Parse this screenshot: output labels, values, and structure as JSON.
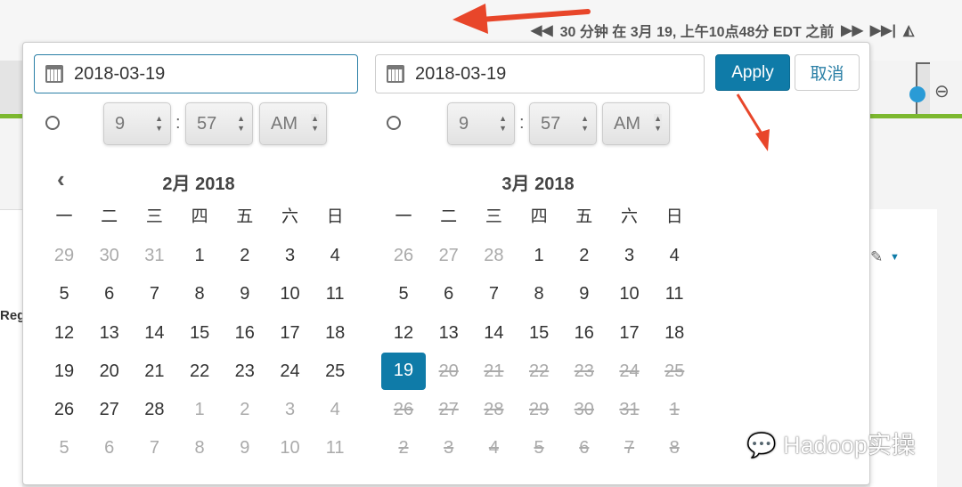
{
  "toolbar": {
    "time_range": "30 分钟 在 3月 19, 上午10点48分 EDT 之前"
  },
  "background": {
    "partial_label": "Reg"
  },
  "picker": {
    "start": {
      "date": "2018-03-19",
      "hour": "9",
      "minute": "57",
      "ampm": "AM"
    },
    "end": {
      "date": "2018-03-19",
      "hour": "9",
      "minute": "57",
      "ampm": "AM"
    },
    "apply_label": "Apply",
    "cancel_label": "取消",
    "time_sep": ":",
    "weekdays": [
      "一",
      "二",
      "三",
      "四",
      "五",
      "六",
      "日"
    ],
    "months": [
      {
        "title": "2月 2018",
        "weeks": [
          [
            [
              "29",
              "muted"
            ],
            [
              "30",
              "muted"
            ],
            [
              "31",
              "muted"
            ],
            [
              "1",
              ""
            ],
            [
              "2",
              ""
            ],
            [
              "3",
              ""
            ],
            [
              "4",
              ""
            ]
          ],
          [
            [
              "5",
              ""
            ],
            [
              "6",
              ""
            ],
            [
              "7",
              ""
            ],
            [
              "8",
              ""
            ],
            [
              "9",
              ""
            ],
            [
              "10",
              ""
            ],
            [
              "11",
              ""
            ]
          ],
          [
            [
              "12",
              ""
            ],
            [
              "13",
              ""
            ],
            [
              "14",
              ""
            ],
            [
              "15",
              ""
            ],
            [
              "16",
              ""
            ],
            [
              "17",
              ""
            ],
            [
              "18",
              ""
            ]
          ],
          [
            [
              "19",
              ""
            ],
            [
              "20",
              ""
            ],
            [
              "21",
              ""
            ],
            [
              "22",
              ""
            ],
            [
              "23",
              ""
            ],
            [
              "24",
              ""
            ],
            [
              "25",
              ""
            ]
          ],
          [
            [
              "26",
              ""
            ],
            [
              "27",
              ""
            ],
            [
              "28",
              ""
            ],
            [
              "1",
              "muted"
            ],
            [
              "2",
              "muted"
            ],
            [
              "3",
              "muted"
            ],
            [
              "4",
              "muted"
            ]
          ],
          [
            [
              "5",
              "muted"
            ],
            [
              "6",
              "muted"
            ],
            [
              "7",
              "muted"
            ],
            [
              "8",
              "muted"
            ],
            [
              "9",
              "muted"
            ],
            [
              "10",
              "muted"
            ],
            [
              "11",
              "muted"
            ]
          ]
        ]
      },
      {
        "title": "3月 2018",
        "weeks": [
          [
            [
              "26",
              "muted"
            ],
            [
              "27",
              "muted"
            ],
            [
              "28",
              "muted"
            ],
            [
              "1",
              ""
            ],
            [
              "2",
              ""
            ],
            [
              "3",
              ""
            ],
            [
              "4",
              ""
            ]
          ],
          [
            [
              "5",
              ""
            ],
            [
              "6",
              ""
            ],
            [
              "7",
              ""
            ],
            [
              "8",
              ""
            ],
            [
              "9",
              ""
            ],
            [
              "10",
              ""
            ],
            [
              "11",
              ""
            ]
          ],
          [
            [
              "12",
              ""
            ],
            [
              "13",
              ""
            ],
            [
              "14",
              ""
            ],
            [
              "15",
              ""
            ],
            [
              "16",
              ""
            ],
            [
              "17",
              ""
            ],
            [
              "18",
              ""
            ]
          ],
          [
            [
              "19",
              "selected"
            ],
            [
              "20",
              "disabled"
            ],
            [
              "21",
              "disabled"
            ],
            [
              "22",
              "disabled"
            ],
            [
              "23",
              "disabled"
            ],
            [
              "24",
              "disabled"
            ],
            [
              "25",
              "disabled"
            ]
          ],
          [
            [
              "26",
              "disabled"
            ],
            [
              "27",
              "disabled"
            ],
            [
              "28",
              "disabled"
            ],
            [
              "29",
              "disabled"
            ],
            [
              "30",
              "disabled"
            ],
            [
              "31",
              "disabled"
            ],
            [
              "1",
              "disabled"
            ]
          ],
          [
            [
              "2",
              "disabled"
            ],
            [
              "3",
              "disabled"
            ],
            [
              "4",
              "disabled"
            ],
            [
              "5",
              "disabled"
            ],
            [
              "6",
              "disabled"
            ],
            [
              "7",
              "disabled"
            ],
            [
              "8",
              "disabled"
            ]
          ]
        ]
      }
    ]
  },
  "watermark": "Hadoop实操",
  "colors": {
    "accent": "#0f7ba8",
    "annotation": "#e8462a",
    "green": "#7cb82f"
  }
}
